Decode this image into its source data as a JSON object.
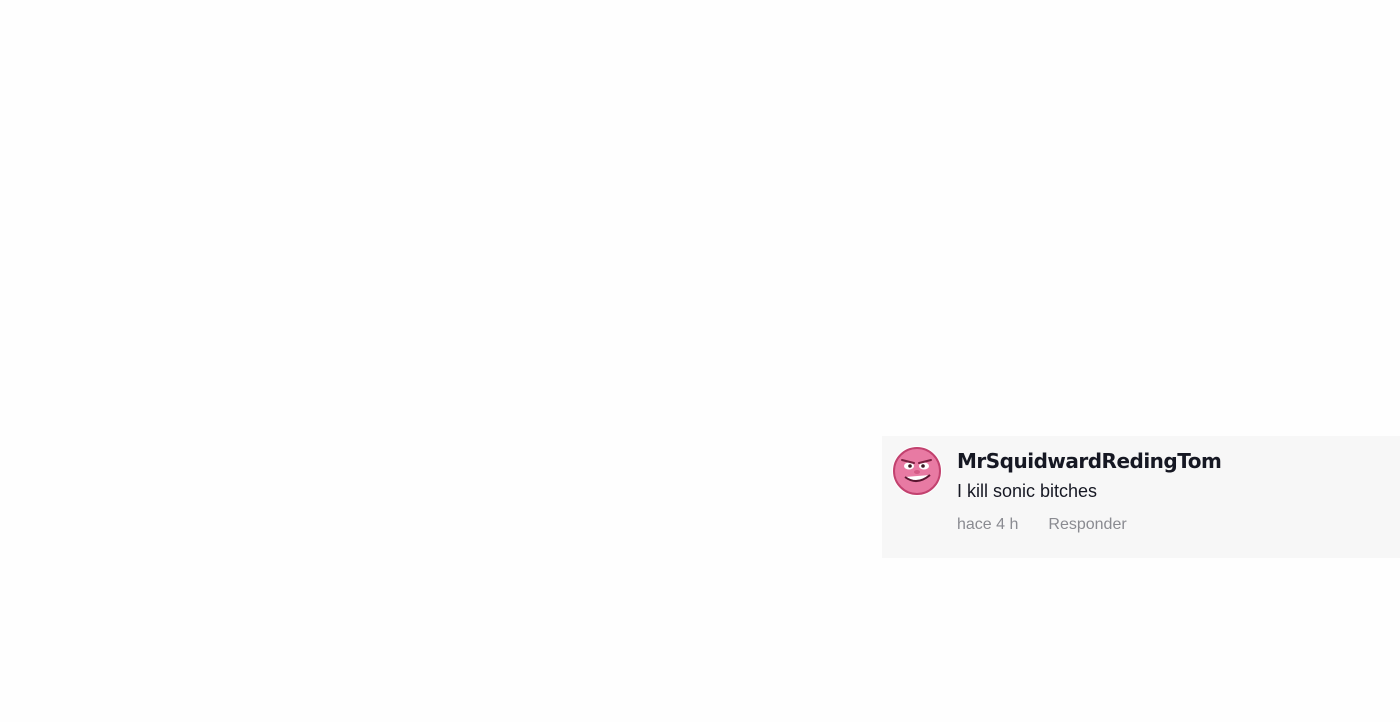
{
  "comment": {
    "username": "MrSquidwardRedingTom",
    "text": "I kill sonic bitches",
    "timestamp": "hace 4 h",
    "reply_label": "Responder",
    "avatar_icon": "pink-face-avatar-icon"
  },
  "colors": {
    "page_background": "#fefefe",
    "card_background": "#f7f7f7",
    "text_primary": "#161823",
    "text_secondary": "#8a8b91",
    "avatar_pink": "#e87aa3"
  }
}
